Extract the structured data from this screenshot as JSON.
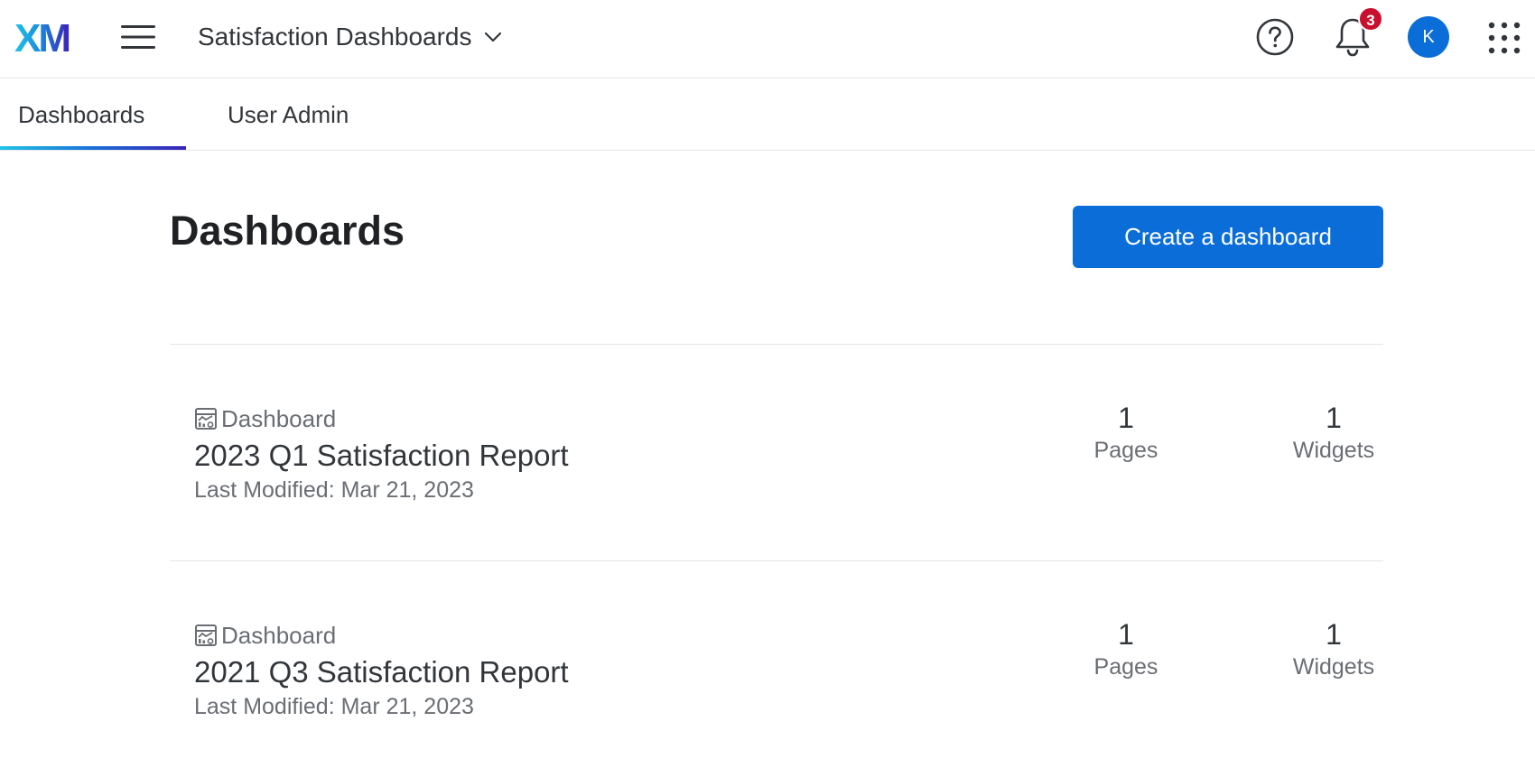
{
  "header": {
    "logo_text": "XM",
    "project_name": "Satisfaction Dashboards",
    "notification_count": "3",
    "avatar_initial": "K"
  },
  "tabs": [
    {
      "label": "Dashboards",
      "active": true
    },
    {
      "label": "User Admin",
      "active": false
    }
  ],
  "main": {
    "title": "Dashboards",
    "create_button_label": "Create a dashboard"
  },
  "dashboards": [
    {
      "type_label": "Dashboard",
      "name": "2023 Q1 Satisfaction Report",
      "modified": "Last Modified: Mar 21, 2023",
      "pages_value": "1",
      "pages_label": "Pages",
      "widgets_value": "1",
      "widgets_label": "Widgets"
    },
    {
      "type_label": "Dashboard",
      "name": "2021 Q3 Satisfaction Report",
      "modified": "Last Modified: Mar 21, 2023",
      "pages_value": "1",
      "pages_label": "Pages",
      "widgets_value": "1",
      "widgets_label": "Widgets"
    }
  ],
  "colors": {
    "primary": "#0b6ed8",
    "badge": "#c8102e",
    "logo_start": "#21c4e8",
    "logo_end": "#3b23b8"
  }
}
